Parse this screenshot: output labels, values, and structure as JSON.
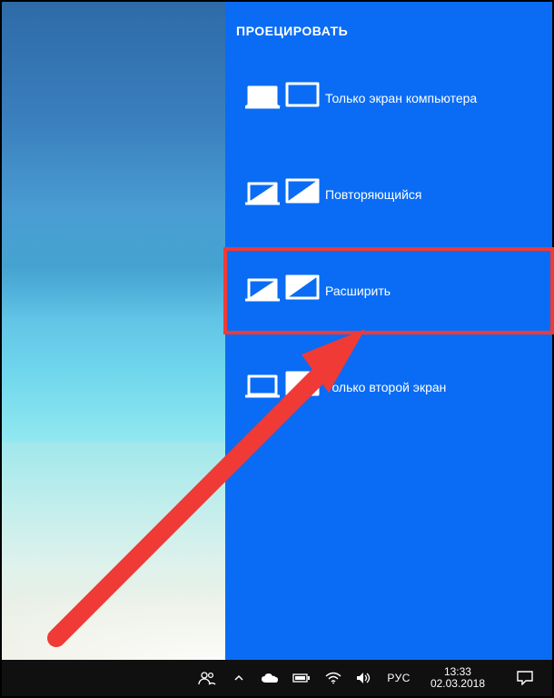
{
  "panel": {
    "title": "ПРОЕЦИРОВАТЬ",
    "options": [
      {
        "label": "Только экран компьютера"
      },
      {
        "label": "Повторяющийся"
      },
      {
        "label": "Расширить"
      },
      {
        "label": "Только второй экран"
      }
    ]
  },
  "taskbar": {
    "lang": "РУС",
    "time": "13:33",
    "date": "02.03.2018"
  }
}
